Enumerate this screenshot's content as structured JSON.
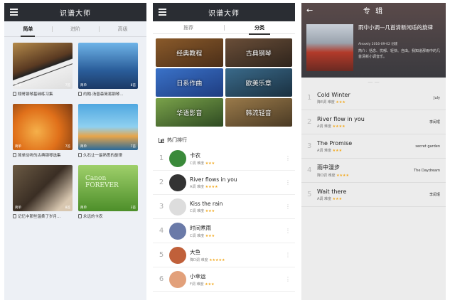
{
  "panel1": {
    "title": "识谱大师",
    "tabs": [
      "简单",
      "进阶",
      "高级"
    ],
    "cards": [
      {
        "title": "翔哥钢琴基础练习集",
        "level": "简单",
        "count": "7首"
      },
      {
        "title": "约翰·汤普森简易钢琴...",
        "level": "简单",
        "count": "8首"
      },
      {
        "title": "简单动听的古典钢琴选集",
        "level": "简单",
        "count": "7首"
      },
      {
        "title": "久石让一最熟悉的旋律",
        "level": "简单",
        "count": "7首"
      },
      {
        "title": "记忆中那些温柔了岁月...",
        "level": "简单",
        "count": "8首"
      },
      {
        "title": "永远的卡农",
        "level": "简单",
        "count": "3首"
      }
    ],
    "canon_text": "Canon FOREVER"
  },
  "panel2": {
    "title": "识谱大师",
    "tabs": [
      "推荐",
      "分类"
    ],
    "categories": [
      "经典教程",
      "古典钢琴",
      "日系作曲",
      "欧美乐章",
      "华语影音",
      "韩流轻音"
    ],
    "ranking_label": "热门排行",
    "ranking": [
      {
        "rank": "1",
        "name": "卡农",
        "key": "C调",
        "diff_label": "难度",
        "stars": "★★★"
      },
      {
        "rank": "2",
        "name": "River flows in you",
        "key": "A调",
        "diff_label": "难度",
        "stars": "★★★★"
      },
      {
        "rank": "3",
        "name": "Kiss the rain",
        "key": "C调",
        "diff_label": "难度",
        "stars": "★★★"
      },
      {
        "rank": "4",
        "name": "时间煮雨",
        "key": "C调",
        "diff_label": "难度",
        "stars": "★★★"
      },
      {
        "rank": "5",
        "name": "大鱼",
        "key": "降D调",
        "diff_label": "难度",
        "stars": "★★★★★"
      },
      {
        "rank": "6",
        "name": "小幸运",
        "key": "F调",
        "diff_label": "难度",
        "stars": "★★★"
      }
    ]
  },
  "panel3": {
    "title": "专 辑",
    "album_title": "雨中小调—几首清新闲适的旋律",
    "author": "Alexwly   2016-09-02 创建",
    "desc": "简介：恬念、忧郁、轻快、自由。我知道那雨中的几首清新小调音乐。",
    "songs": [
      {
        "no": "1",
        "name": "Cold Winter",
        "key": "降E调",
        "diff_label": "难度",
        "stars": "★★★",
        "artist": "July"
      },
      {
        "no": "2",
        "name": "River flow in you",
        "key": "A调",
        "diff_label": "难度",
        "stars": "★★★★",
        "artist": "李闰珉"
      },
      {
        "no": "3",
        "name": "The Promise",
        "key": "A调",
        "diff_label": "难度",
        "stars": "★★★",
        "artist": "secret garden"
      },
      {
        "no": "4",
        "name": "雨中漫步",
        "key": "降D调",
        "diff_label": "难度",
        "stars": "★★★★",
        "artist": "The Daydream"
      },
      {
        "no": "5",
        "name": "Wait there",
        "key": "A调",
        "diff_label": "难度",
        "stars": "★★★",
        "artist": "李闰珉"
      }
    ]
  },
  "colors": {
    "topbar": "#2a2d33",
    "star": "#f2a81c"
  }
}
